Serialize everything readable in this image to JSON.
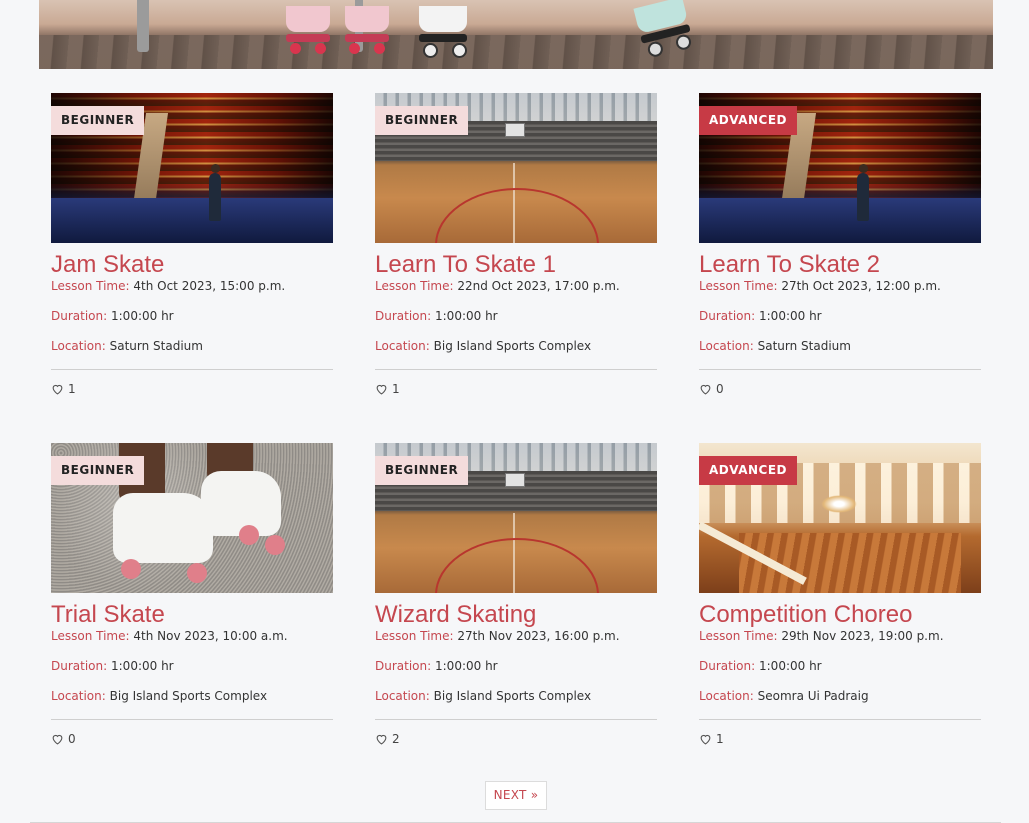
{
  "labels": {
    "lesson_time": "Lesson Time:",
    "duration": "Duration:",
    "location": "Location:"
  },
  "lessons": [
    {
      "level": "BEGINNER",
      "title": "Jam Skate",
      "lesson_time": "4th Oct 2023, 15:00 p.m.",
      "duration": "1:00:00 hr",
      "location": "Saturn Stadium",
      "likes": "1"
    },
    {
      "level": "BEGINNER",
      "title": "Learn To Skate 1",
      "lesson_time": "22nd Oct 2023, 17:00 p.m.",
      "duration": "1:00:00 hr",
      "location": "Big Island Sports Complex",
      "likes": "1"
    },
    {
      "level": "ADVANCED",
      "title": "Learn To Skate 2",
      "lesson_time": "27th Oct 2023, 12:00 p.m.",
      "duration": "1:00:00 hr",
      "location": "Saturn Stadium",
      "likes": "0"
    },
    {
      "level": "BEGINNER",
      "title": "Trial Skate",
      "lesson_time": "4th Nov 2023, 10:00 a.m.",
      "duration": "1:00:00 hr",
      "location": "Big Island Sports Complex",
      "likes": "0"
    },
    {
      "level": "BEGINNER",
      "title": "Wizard Skating",
      "lesson_time": "27th Nov 2023, 16:00 p.m.",
      "duration": "1:00:00 hr",
      "location": "Big Island Sports Complex",
      "likes": "2"
    },
    {
      "level": "ADVANCED",
      "title": "Competition Choreo",
      "lesson_time": "29th Nov 2023, 19:00 p.m.",
      "duration": "1:00:00 hr",
      "location": "Seomra Ui Padraig",
      "likes": "1"
    }
  ],
  "pagination": {
    "next_label": "NEXT »"
  },
  "colors": {
    "accent": "#c5474f",
    "beginner_badge": "#f4dcdc",
    "advanced_badge": "#c73a45",
    "background": "#f6f7f9"
  },
  "icons": {
    "like": "heart-outline-icon"
  }
}
